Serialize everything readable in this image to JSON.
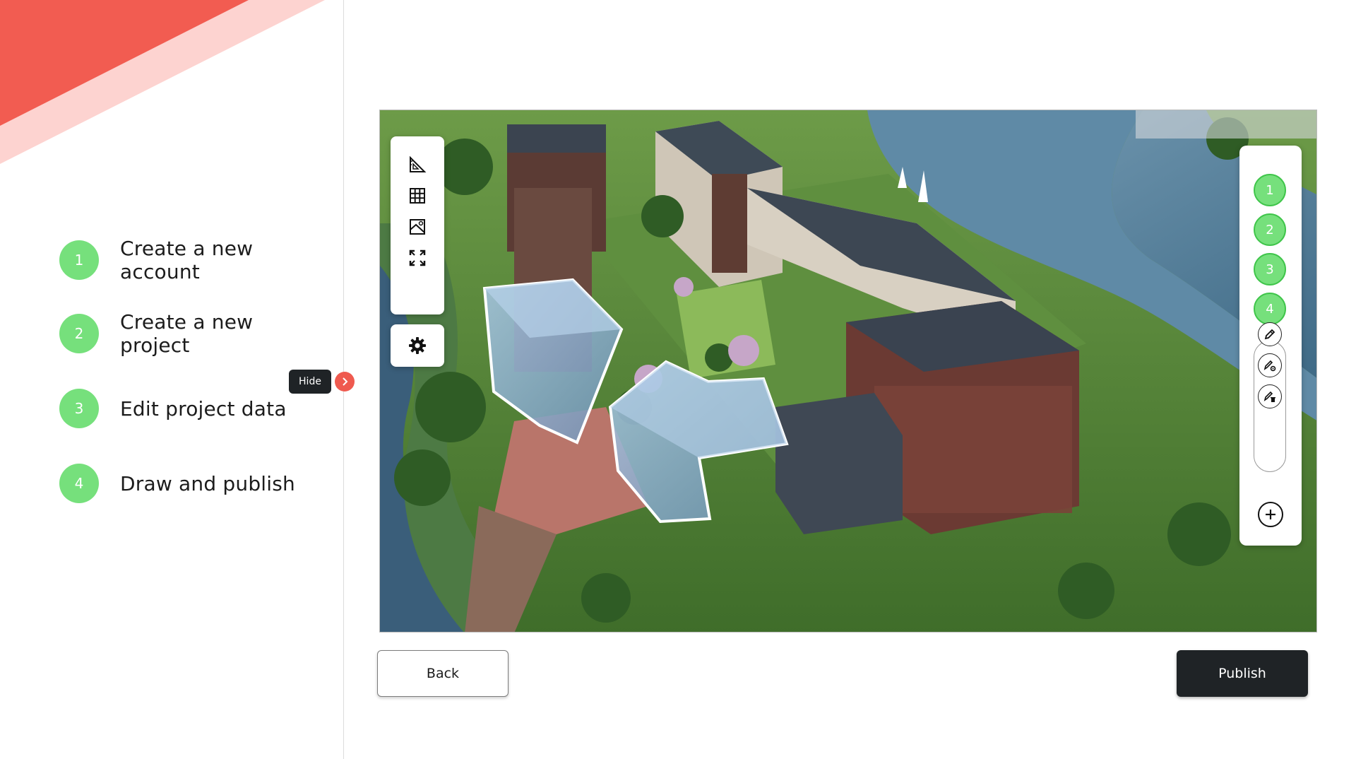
{
  "sidebar": {
    "steps": [
      {
        "number": "1",
        "label": "Create a new account"
      },
      {
        "number": "2",
        "label": "Create a new project"
      },
      {
        "number": "3",
        "label": "Edit project data"
      },
      {
        "number": "4",
        "label": "Draw and publish"
      }
    ],
    "hide_tooltip": "Hide",
    "toggle_icon": "chevron-right-icon"
  },
  "viewer": {
    "tools": [
      "ruler-triangle-icon",
      "grid-icon",
      "map-image-icon",
      "fullscreen-icon"
    ],
    "settings_icon": "gear-icon",
    "layers": [
      "1",
      "2",
      "3",
      "4"
    ],
    "layer_tools": [
      "pencil-icon",
      "pencil-settings-icon",
      "pencil-delete-icon"
    ],
    "add_icon": "plus-circle-icon"
  },
  "footer": {
    "back_label": "Back",
    "publish_label": "Publish"
  },
  "colors": {
    "accent_red": "#f25c51",
    "step_green": "#76e07c",
    "dark": "#1f2326"
  }
}
